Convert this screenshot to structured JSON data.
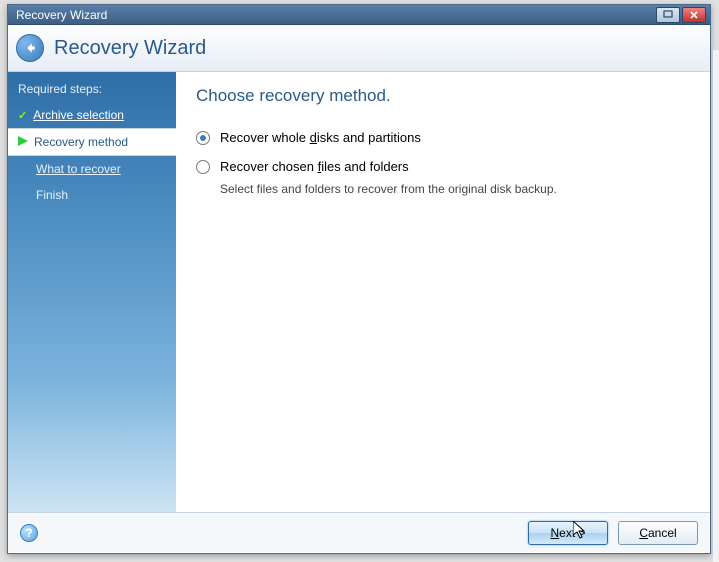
{
  "window": {
    "title": "Recovery Wizard"
  },
  "header": {
    "title": "Recovery Wizard"
  },
  "sidebar": {
    "required_label": "Required steps:",
    "steps": {
      "archive": "Archive selection",
      "method": "Recovery method",
      "what": "What to recover",
      "finish": "Finish"
    },
    "faded": {
      "a": "",
      "b": ""
    }
  },
  "content": {
    "title": "Choose recovery method.",
    "option1": {
      "pre": "Recover whole ",
      "key": "d",
      "post": "isks and partitions",
      "selected": true
    },
    "option2": {
      "pre": "Recover chosen ",
      "key": "f",
      "post": "iles and folders",
      "desc": "Select files and folders to recover from the original disk backup."
    }
  },
  "footer": {
    "next": {
      "pre": "",
      "key": "N",
      "post": "ext >"
    },
    "cancel": {
      "pre": "",
      "key": "C",
      "post": "ancel"
    }
  }
}
